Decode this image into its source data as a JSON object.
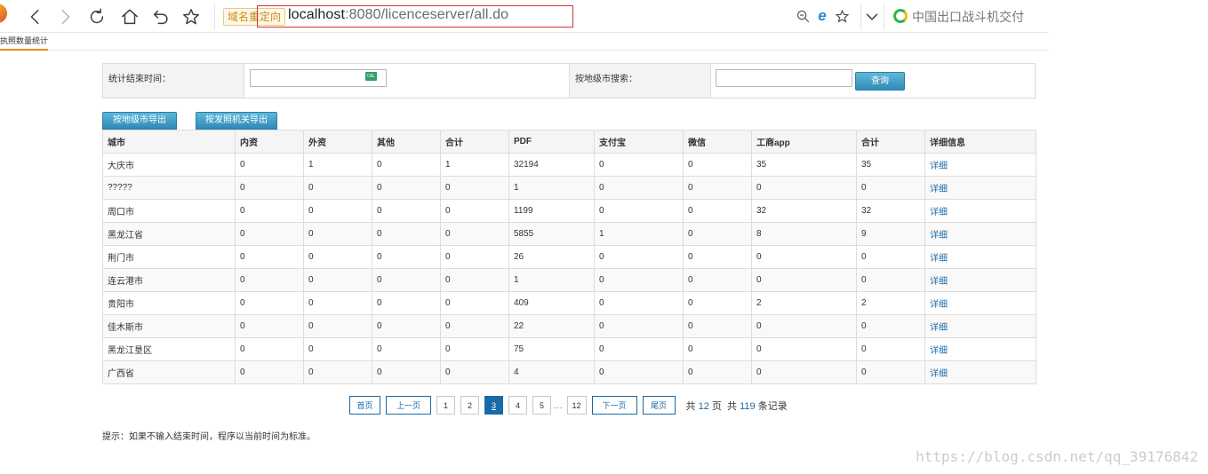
{
  "browser": {
    "redirect_badge": "域名重定向",
    "url_host": "localhost",
    "url_rest": ":8080/licenceserver/all.do",
    "search_text": "中国出口战斗机交付"
  },
  "tab": {
    "title": "执照数量统计"
  },
  "filter": {
    "end_time_label": "统计结束时间：",
    "end_time_value": "",
    "city_search_label": "按地级市搜索：",
    "city_search_value": "",
    "query_button": "查询",
    "calendar_icon_text": "CAL"
  },
  "export": {
    "by_city": "按地级市导出",
    "by_agency": "按发照机关导出"
  },
  "table": {
    "headers": [
      "城市",
      "内资",
      "外资",
      "其他",
      "合计",
      "PDF",
      "支付宝",
      "微信",
      "工商app",
      "合计",
      "详细信息"
    ],
    "detail_link": "详细",
    "rows": [
      [
        "大庆市",
        "0",
        "1",
        "0",
        "1",
        "32194",
        "0",
        "0",
        "35",
        "35"
      ],
      [
        "?????",
        "0",
        "0",
        "0",
        "0",
        "1",
        "0",
        "0",
        "0",
        "0"
      ],
      [
        "周口市",
        "0",
        "0",
        "0",
        "0",
        "1199",
        "0",
        "0",
        "32",
        "32"
      ],
      [
        "黑龙江省",
        "0",
        "0",
        "0",
        "0",
        "5855",
        "1",
        "0",
        "8",
        "9"
      ],
      [
        "荆门市",
        "0",
        "0",
        "0",
        "0",
        "26",
        "0",
        "0",
        "0",
        "0"
      ],
      [
        "连云港市",
        "0",
        "0",
        "0",
        "0",
        "1",
        "0",
        "0",
        "0",
        "0"
      ],
      [
        "贵阳市",
        "0",
        "0",
        "0",
        "0",
        "409",
        "0",
        "0",
        "2",
        "2"
      ],
      [
        "佳木斯市",
        "0",
        "0",
        "0",
        "0",
        "22",
        "0",
        "0",
        "0",
        "0"
      ],
      [
        "黑龙江垦区",
        "0",
        "0",
        "0",
        "0",
        "75",
        "0",
        "0",
        "0",
        "0"
      ],
      [
        "广西省",
        "0",
        "0",
        "0",
        "0",
        "4",
        "0",
        "0",
        "0",
        "0"
      ]
    ]
  },
  "pager": {
    "first": "首页",
    "prev": "上一页",
    "pages": [
      "1",
      "2",
      "3",
      "4",
      "5"
    ],
    "current": "3",
    "dots": "...",
    "last_page": "12",
    "next": "下一页",
    "last": "尾页",
    "info_prefix": "共",
    "total_pages": "12",
    "info_pages_suffix": "页",
    "info_records_prefix": "共",
    "total_records": "119",
    "info_records_suffix": "条记录"
  },
  "hint": "提示：如果不输入结束时间，程序以当前时间为标准。",
  "watermark": "https://blog.csdn.net/qq_39176842"
}
